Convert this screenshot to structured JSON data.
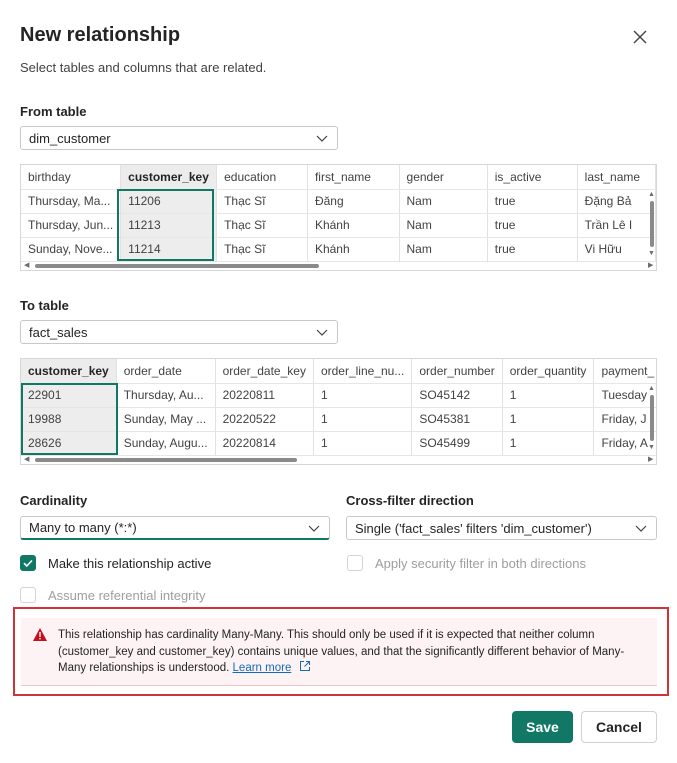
{
  "dialog": {
    "title": "New relationship",
    "subtitle": "Select tables and columns that are related."
  },
  "from_table": {
    "label": "From table",
    "selected": "dim_customer",
    "columns": [
      "birthday",
      "customer_key",
      "education",
      "first_name",
      "gender",
      "is_active",
      "last_name"
    ],
    "rows": [
      [
        "Thursday, Ma...",
        "11206",
        "Thạc Sĩ",
        "Đăng",
        "Nam",
        "true",
        "Đặng Bả"
      ],
      [
        "Thursday, Jun...",
        "11213",
        "Thạc Sĩ",
        "Khánh",
        "Nam",
        "true",
        "Trần Lê I"
      ],
      [
        "Sunday, Nove...",
        "11214",
        "Thạc Sĩ",
        "Khánh",
        "Nam",
        "true",
        "Vi Hữu"
      ]
    ],
    "selected_column": "customer_key"
  },
  "to_table": {
    "label": "To table",
    "selected": "fact_sales",
    "columns": [
      "customer_key",
      "order_date",
      "order_date_key",
      "order_line_nu...",
      "order_number",
      "order_quantity",
      "payment_"
    ],
    "rows": [
      [
        "22901",
        "Thursday, Au...",
        "20220811",
        "1",
        "SO45142",
        "1",
        "Tuesday"
      ],
      [
        "19988",
        "Sunday, May ...",
        "20220522",
        "1",
        "SO45381",
        "1",
        "Friday, J"
      ],
      [
        "28626",
        "Sunday, Augu...",
        "20220814",
        "1",
        "SO45499",
        "1",
        "Friday, A"
      ]
    ],
    "selected_column": "customer_key"
  },
  "cardinality": {
    "label": "Cardinality",
    "selected": "Many to many (*:*)"
  },
  "cross_filter": {
    "label": "Cross-filter direction",
    "selected": "Single ('fact_sales' filters 'dim_customer')"
  },
  "options": {
    "make_active": {
      "label": "Make this relationship active",
      "checked": true
    },
    "security_filter": {
      "label": "Apply security filter in both directions",
      "checked": false
    },
    "referential_integrity": {
      "label": "Assume referential integrity",
      "checked": false
    }
  },
  "warning": {
    "text": "This relationship has cardinality Many-Many. This should only be used if it is expected that neither column (customer_key and customer_key) contains unique values, and that the significantly different behavior of Many-Many relationships is understood.",
    "link": "Learn more"
  },
  "buttons": {
    "save": "Save",
    "cancel": "Cancel"
  },
  "colors": {
    "accent": "#117865",
    "warning_border": "#d13438",
    "warning_bg": "#fdf3f4",
    "link": "#0f6cbd"
  },
  "icons": [
    "close-icon",
    "chevron-down-icon",
    "checkmark-icon",
    "warning-icon",
    "open-external-icon"
  ]
}
